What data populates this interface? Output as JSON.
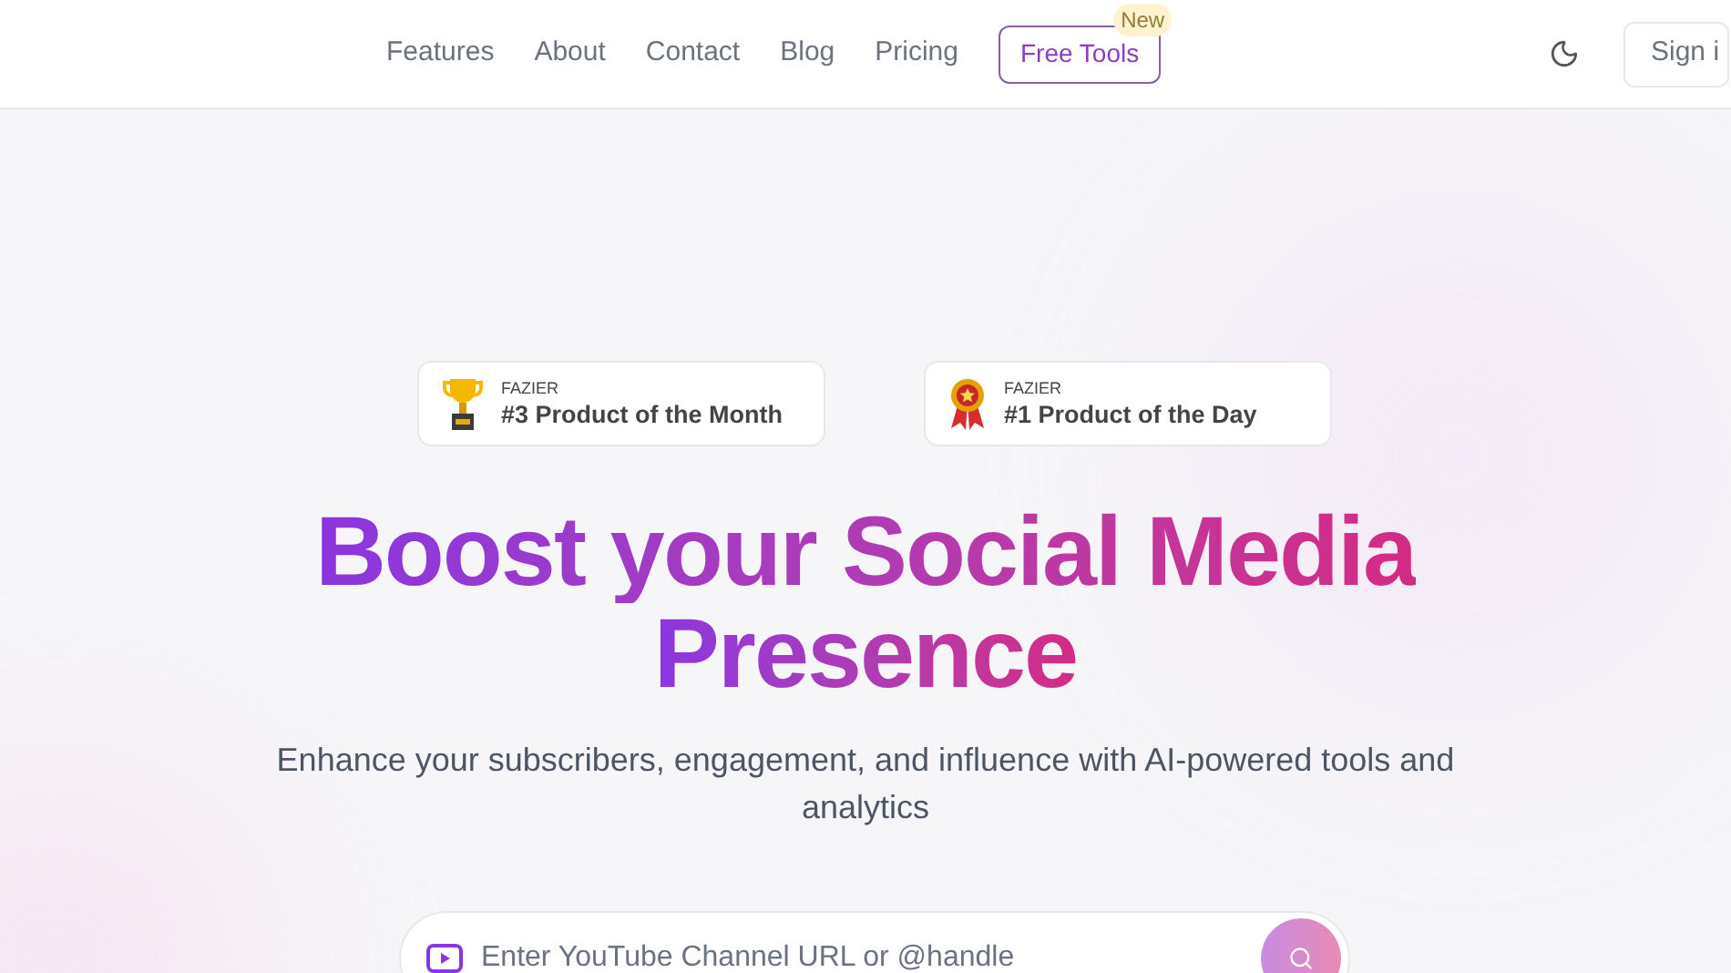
{
  "header": {
    "nav": [
      {
        "label": "Features"
      },
      {
        "label": "About"
      },
      {
        "label": "Contact"
      },
      {
        "label": "Blog"
      },
      {
        "label": "Pricing"
      }
    ],
    "free_tools": {
      "label": "Free Tools",
      "badge": "New"
    },
    "sign_in": "Sign i"
  },
  "awards": [
    {
      "kind": "trophy",
      "source": "FAZIER",
      "title": "#3 Product of the Month"
    },
    {
      "kind": "medal",
      "source": "FAZIER",
      "title": "#1 Product of the Day"
    }
  ],
  "hero": {
    "title_lines": [
      "Boost your Social Media",
      "Presence"
    ],
    "subtitle": "Enhance your subscribers, engagement, and influence with AI-powered tools and analytics"
  },
  "search": {
    "placeholder": "Enter YouTube Channel URL or @handle"
  }
}
